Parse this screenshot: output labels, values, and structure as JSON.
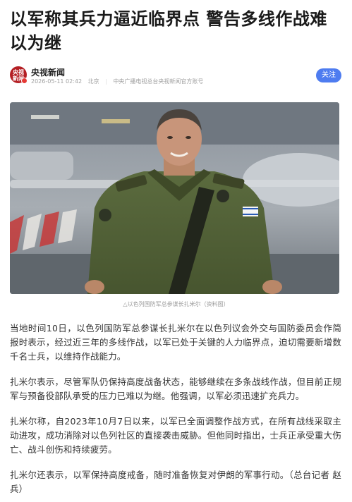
{
  "article": {
    "title": "以军称其兵力逼近临界点 警告多线作战难以为继",
    "source": {
      "avatar_text": "央视新闻",
      "name": "央视新闻",
      "date": "2026-05-11 02:42",
      "location": "北京",
      "description": "中央广播电视总台央视新闻官方账号"
    },
    "follow_label": "关注",
    "image_caption": "△以色列国防军总参谋长扎米尔（资料图）",
    "paragraphs": [
      "当地时间10日，以色列国防军总参谋长扎米尔在以色列议会外交与国防委员会作简报时表示，经过近三年的多线作战，以军已处于关键的人力临界点，迫切需要新增数千名士兵，以维持作战能力。",
      "扎米尔表示，尽管军队仍保持高度战备状态，能够继续在多条战线作战，但目前正规军与预备役部队承受的压力已难以为继。他强调，以军必须迅速扩充兵力。",
      "扎米尔称，自2023年10月7日以来，以军已全面调整作战方式，在所有战线采取主动进攻，成功消除对以色列社区的直接袭击威胁。但他同时指出，士兵正承受重大伤亡、战斗创伤和持续疲劳。",
      "扎米尔还表示，以军保持高度戒备，随时准备恢复对伊朗的军事行动。（总台记者 赵兵）"
    ]
  },
  "colors": {
    "follow_button": "#4e7cf0",
    "avatar_bg": "#b41f24",
    "meta_text": "#a0a0a0"
  }
}
